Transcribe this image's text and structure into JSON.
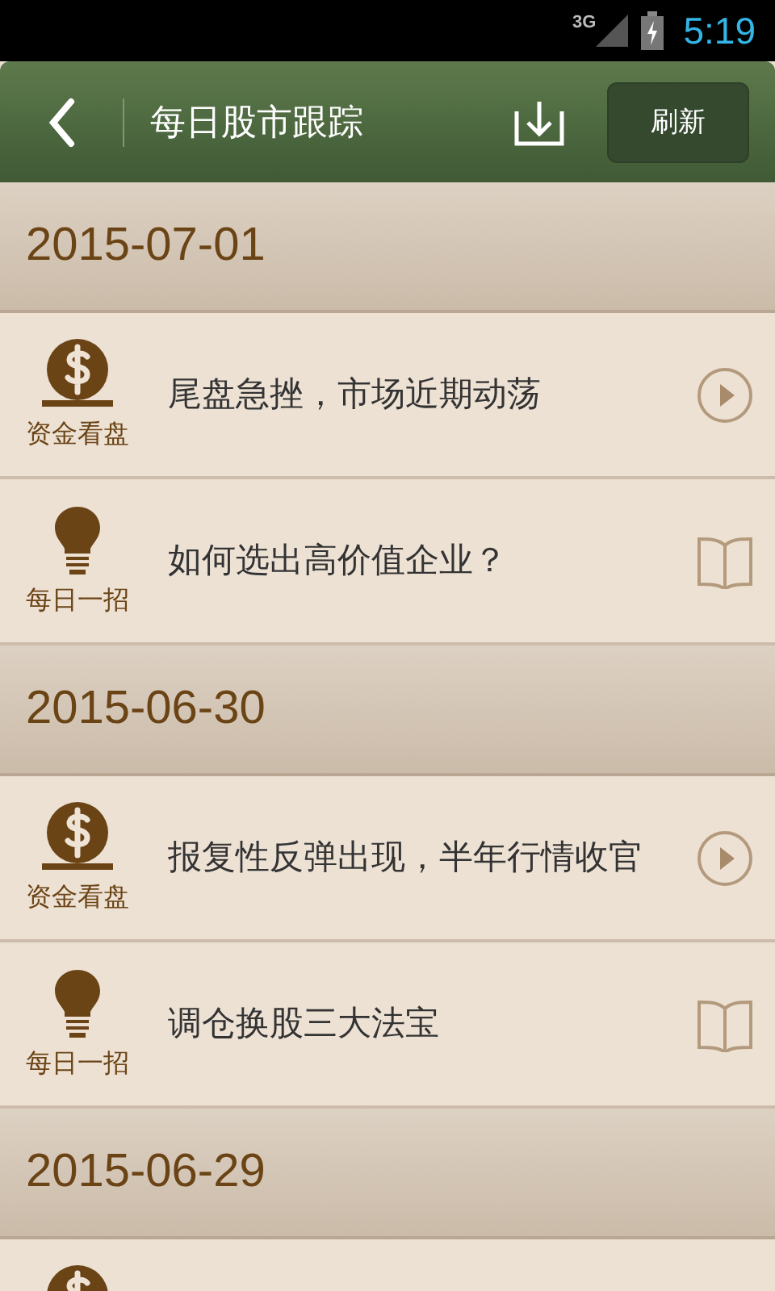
{
  "status_bar": {
    "network": "3G",
    "time": "5:19"
  },
  "header": {
    "title": "每日股市跟踪",
    "refresh": "刷新"
  },
  "sections": [
    {
      "date": "2015-07-01",
      "items": [
        {
          "kind": "money",
          "label": "资金看盘",
          "title": "尾盘急挫，市场近期动荡"
        },
        {
          "kind": "tip",
          "label": "每日一招",
          "title": "如何选出高价值企业？"
        }
      ]
    },
    {
      "date": "2015-06-30",
      "items": [
        {
          "kind": "money",
          "label": "资金看盘",
          "title": "报复性反弹出现，半年行情收官"
        },
        {
          "kind": "tip",
          "label": "每日一招",
          "title": "调仓换股三大法宝"
        }
      ]
    },
    {
      "date": "2015-06-29",
      "items": [
        {
          "kind": "money"
        }
      ]
    }
  ]
}
